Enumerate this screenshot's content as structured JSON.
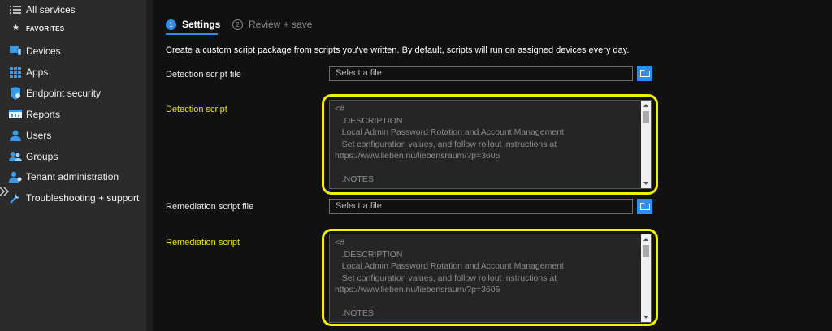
{
  "sidebar": {
    "all_services": "All services",
    "favorites_label": "FAVORITES",
    "items": [
      {
        "label": "Devices",
        "icon": "devices-icon"
      },
      {
        "label": "Apps",
        "icon": "apps-grid-icon"
      },
      {
        "label": "Endpoint security",
        "icon": "shield-icon"
      },
      {
        "label": "Reports",
        "icon": "reports-icon"
      },
      {
        "label": "Users",
        "icon": "user-icon"
      },
      {
        "label": "Groups",
        "icon": "groups-icon"
      },
      {
        "label": "Tenant administration",
        "icon": "tenant-admin-icon"
      },
      {
        "label": "Troubleshooting + support",
        "icon": "wrench-icon"
      }
    ]
  },
  "wizard": {
    "steps": [
      {
        "number": "1",
        "label": "Settings",
        "active": true
      },
      {
        "number": "2",
        "label": "Review + save",
        "active": false
      }
    ]
  },
  "main": {
    "description": "Create a custom script package from scripts you've written. By default, scripts will run on assigned devices every day.",
    "detection_file_label": "Detection script file",
    "detection_file_placeholder": "Select a file",
    "detection_script_label": "Detection script",
    "detection_script_text": "<#\n   .DESCRIPTION\n   Local Admin Password Rotation and Account Management\n   Set configuration values, and follow rollout instructions at\nhttps://www.lieben.nu/liebensraum/?p=3605\n\n   .NOTES",
    "remediation_file_label": "Remediation script file",
    "remediation_file_placeholder": "Select a file",
    "remediation_script_label": "Remediation script",
    "remediation_script_text": "<#\n   .DESCRIPTION\n   Local Admin Password Rotation and Account Management\n   Set configuration values, and follow rollout instructions at\nhttps://www.lieben.nu/liebensraum/?p=3605\n\n   .NOTES"
  },
  "colors": {
    "accent": "#2f8ff0",
    "highlight": "#f3ef00",
    "sidebar_bg": "#2b2b2b"
  }
}
